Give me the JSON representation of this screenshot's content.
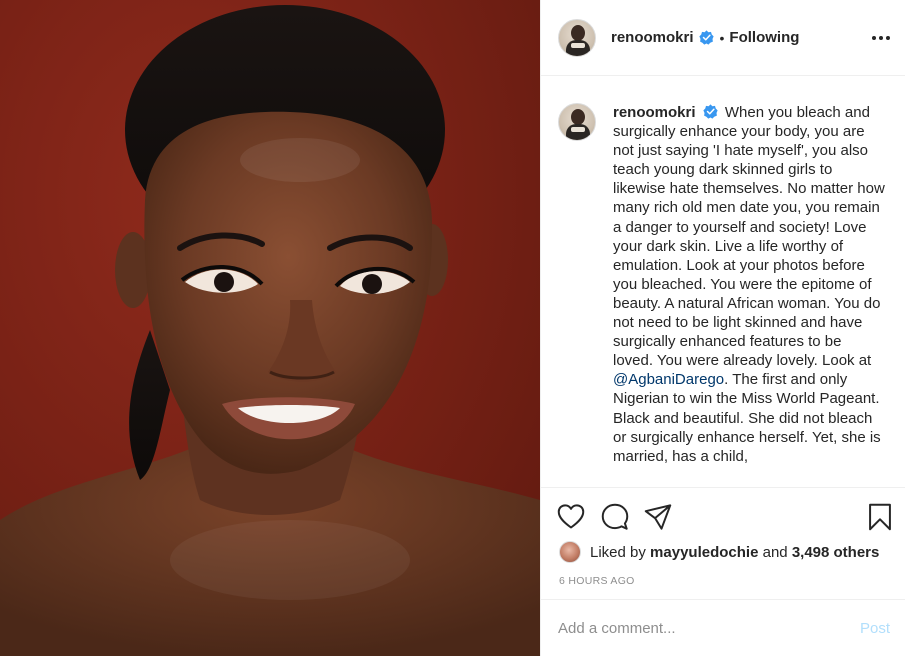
{
  "header": {
    "username": "renoomokri",
    "dot": "•",
    "following_label": "Following",
    "more_icon": "more-horizontal-icon"
  },
  "caption": {
    "username": "renoomokri",
    "text_before_mention": "When you bleach and surgically enhance your body, you are not just saying 'I hate myself', you also teach young dark skinned girls to likewise hate themselves. No matter how many rich old men date you, you remain a danger to yourself and society! Love your dark skin. Live a life worthy of emulation. Look at your photos before you bleached. You were the epitome of beauty. A natural African woman. You do not need to be light skinned and have surgically enhanced features to be loved. You were already lovely. Look at",
    "mention": "@AgbaniDarego",
    "text_after_mention": ". The first and only Nigerian to win the Miss World Pageant. Black and beautiful. She did not bleach or surgically enhance herself. Yet, she is married, has a child,"
  },
  "actions": {
    "like_icon": "heart-icon",
    "comment_icon": "comment-icon",
    "share_icon": "share-icon",
    "save_icon": "bookmark-icon"
  },
  "likes": {
    "prefix": "Liked by",
    "user": "mayyuledochie",
    "conjunction": "and",
    "others": "3,498 others"
  },
  "timestamp": "6 HOURS AGO",
  "comment_box": {
    "placeholder": "Add a comment...",
    "post_label": "Post"
  },
  "colors": {
    "verified": "#3897f0",
    "mention": "#00376b",
    "post_button_disabled": "#b2dffc",
    "photo_background": "#7a2216"
  }
}
